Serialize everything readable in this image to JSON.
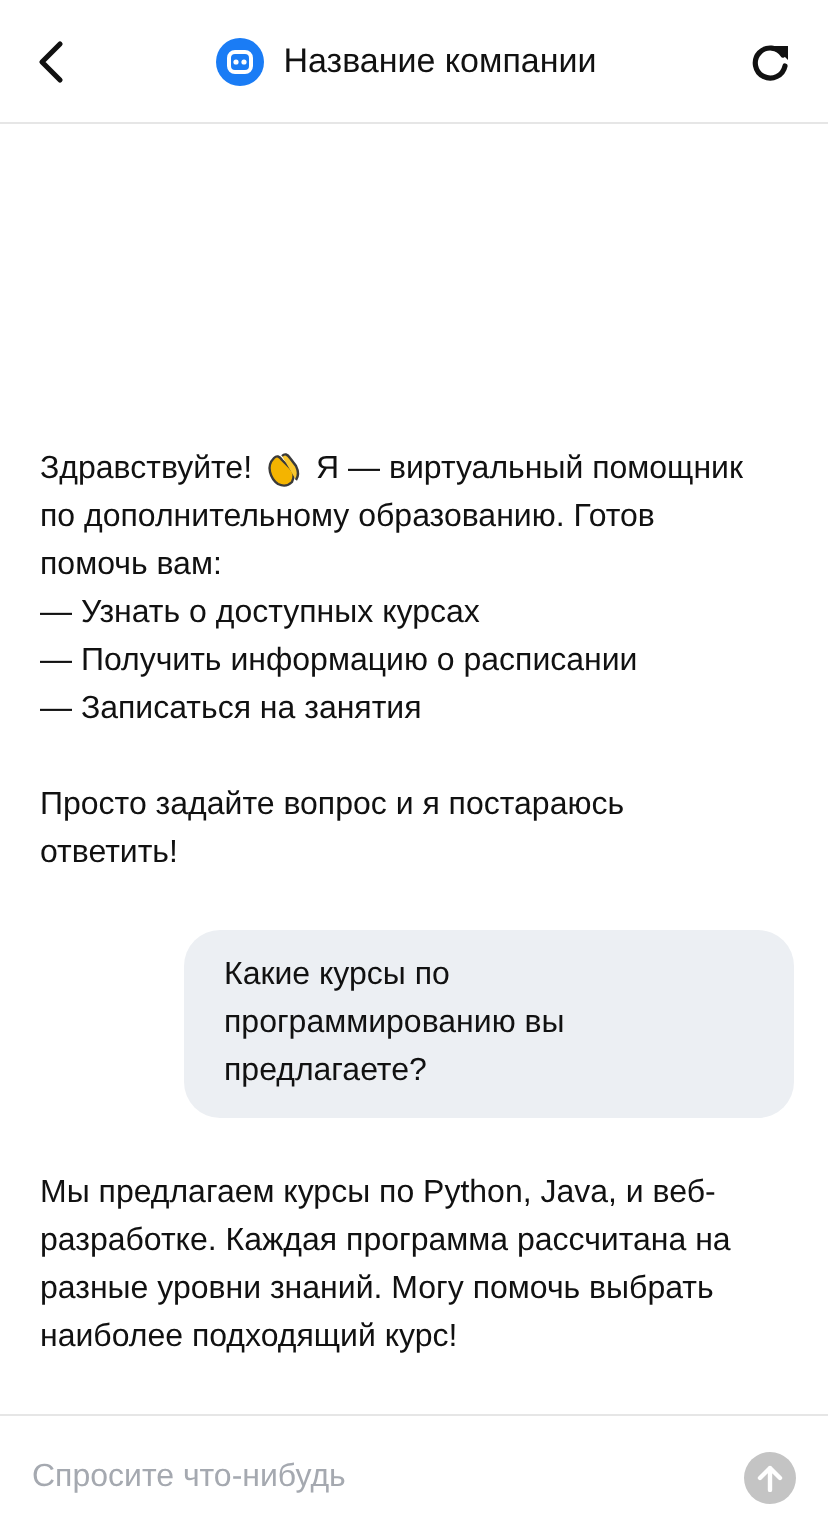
{
  "header": {
    "title": "Название компании"
  },
  "messages": [
    {
      "kind": "bot",
      "greeting": "Здравствуйте!",
      "intro": "Я — виртуальный помощник",
      "text": "по дополнительному образованию. Готов\nпомочь вам:\n— Узнать о доступных курсах\n— Получить информацию о расписании\n— Записаться на занятия\n\nПросто задайте вопрос и я постараюсь\nответить!"
    },
    {
      "kind": "user",
      "text": "Какие курсы по программированию вы предлагаете?"
    },
    {
      "kind": "bot",
      "text": "Мы предлагаем курсы по Python, Java, и веб-разработке. Каждая программа рассчитана на разные уровни знаний. Могу помочь выбрать наиболее подходящий курс!"
    }
  ],
  "composer": {
    "placeholder": "Спросите что-нибудь"
  }
}
